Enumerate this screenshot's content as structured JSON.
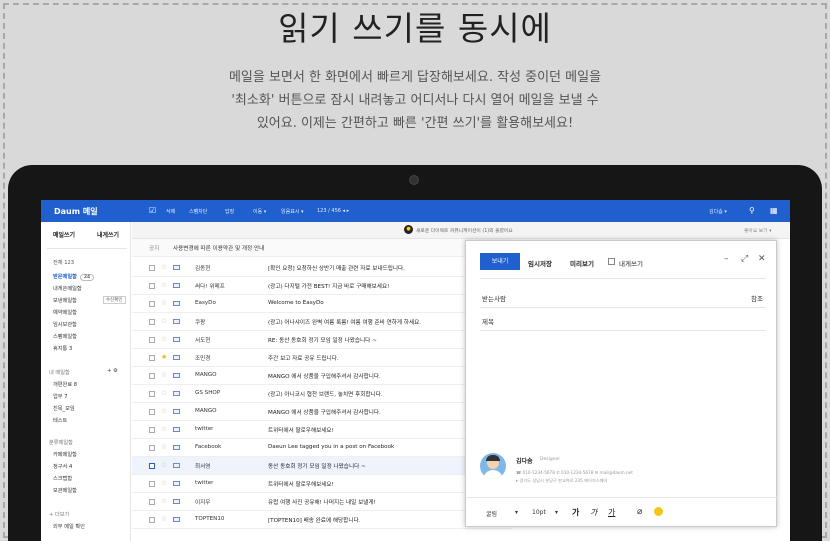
{
  "page": {
    "headline": "읽기 쓰기를 동시에",
    "desc": [
      "메일을 보면서 한 화면에서 빠르게 답장해보세요. 작성 중이던 메일을",
      "'최소화' 버튼으로 잠시 내려놓고 어디서나  다시 열어 메일을 보낼 수",
      "있어요. 이제는 간편하고 빠른 '간편 쓰기'를 활용해보세요!"
    ]
  },
  "app": {
    "logo": "Daum 메일",
    "toolbar": [
      "삭제",
      "스팸차단",
      "답장",
      "이동 ▾",
      "읽음표시 ▾",
      "123 / 456 ◂ ▸"
    ],
    "user": "김다솜 ▾"
  },
  "sidebar": {
    "write": "메일쓰기",
    "self": "내게쓰기",
    "all": "전체 123",
    "write_mini": "수신확인",
    "folders": [
      "받은메일함",
      "내게쓴메일함",
      "보낸메일함",
      "예약메일함",
      "임시보관함",
      "스팸메일함",
      "휴지통 3"
    ],
    "inbox_count": "24",
    "my_head": "내 메일함",
    "my": [
      "개편완료 8",
      "업무 7",
      "친목_모임",
      "테스트"
    ],
    "etc_head": "분류메일함",
    "etc": [
      "카페메일함",
      "청구서 4",
      "스크랩함",
      "보관메일함"
    ],
    "bottom_head": "+ 더보기",
    "bottom": [
      "외부 메일 확인"
    ]
  },
  "notice": {
    "text": "새로운 다이렉트 커뮤니케이션이 (1)외 올렸어요",
    "right": "좋아요 보기 ▾"
  },
  "mails": [
    {
      "sender": "공지",
      "subject": "사용변경에 따른 이용약관 및 개정 안내"
    },
    {
      "sender": "김동현",
      "subject": "[확인 요청] 요청하신 상반기 매출 관련 자료 보내드립니다."
    },
    {
      "sender": "써다! 위메프",
      "subject": "(광고) 다지털 가전 BEST! 지금 바로 구매해보세요!"
    },
    {
      "sender": "EasyDo",
      "subject": "Welcome to EasyDo"
    },
    {
      "sender": "쿠팡",
      "subject": "(광고) 어나샤이즈 완벽 여름 룩룸! 여름 여행 준비 연하게 하세요."
    },
    {
      "sender": "서도현",
      "subject": "RE: 동산 동호회 정기 모임 일정 나왔습니다 ~"
    },
    {
      "sender": "조민경",
      "subject": "주간 보고 자료 공유 드립니다."
    },
    {
      "sender": "MANGO",
      "subject": "MANGO 에서 상품을 구입해주셔서 감사합니다."
    },
    {
      "sender": "GS SHOP",
      "subject": "(광고) 아니코시 협찬 브랜드, 놓치면 후회합니다."
    },
    {
      "sender": "MANGO",
      "subject": "MANGO 에서 상품을 구입해주셔서 감사합니다."
    },
    {
      "sender": "twitter",
      "subject": "트위터에서 팔로우해보세요!"
    },
    {
      "sender": "Facebook",
      "subject": "Daeun Lee tagged you in a post on Facebook"
    },
    {
      "sender": "최서영",
      "subject": "동산 동호회 정기 모임 일정 나왔습니다 ~"
    },
    {
      "sender": "twitter",
      "subject": "트위터에서 팔로우해보세요!"
    },
    {
      "sender": "이지우",
      "subject": "유럽 여행 사진 공유해! 나머지는 내일 보낼게!"
    },
    {
      "sender": "TOPTEN10",
      "subject": "[TOPTEN10] 배송 완료에 해당합니다."
    }
  ],
  "compose": {
    "send": "보내기",
    "save": "임시저장",
    "preview": "미리보기",
    "self": "내게쓰기",
    "to": "받는사람",
    "cc": "참조",
    "subject": "제목",
    "sig": {
      "name": "김다솜",
      "title": "Designer",
      "line1": "☎ 010-1234-5678  ✆ 010-1234-5678  ✉ mail@daum.net",
      "line2": "▸ 경기도 성남시 분당구 판교역로 235 에이치스퀘어"
    },
    "font": "굴림",
    "size": "10pt",
    "b": "가",
    "i": "가",
    "u": "가"
  }
}
